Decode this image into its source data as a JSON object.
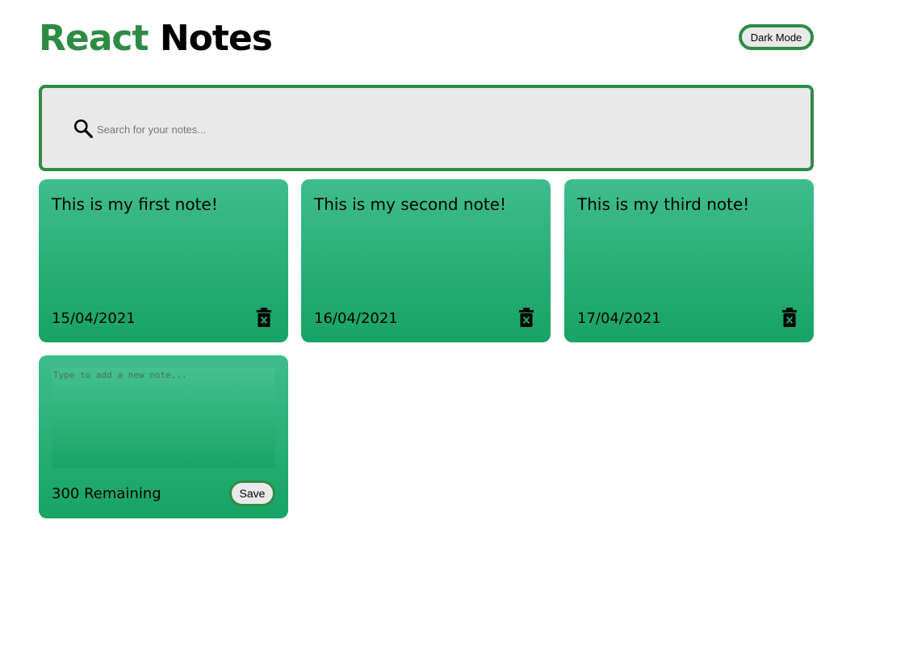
{
  "header": {
    "title_accent": "React",
    "title_main": "Notes",
    "toggle_label": "Dark Mode"
  },
  "search": {
    "icon": "search-icon",
    "placeholder": "Search for your notes..."
  },
  "notes": [
    {
      "text": "This is my first note!",
      "date": "15/04/2021",
      "icon": "delete-icon"
    },
    {
      "text": "This is my second note!",
      "date": "16/04/2021",
      "icon": "delete-icon"
    },
    {
      "text": "This is my third note!",
      "date": "17/04/2021",
      "icon": "delete-icon"
    }
  ],
  "new_note": {
    "placeholder": "Type to add a new note...",
    "remaining": "300 Remaining",
    "save_label": "Save"
  },
  "colors": {
    "accent": "#2e8b45",
    "note_top": "#3fbc8e",
    "note_bottom": "#17a363",
    "panel": "#e9e9e9"
  }
}
